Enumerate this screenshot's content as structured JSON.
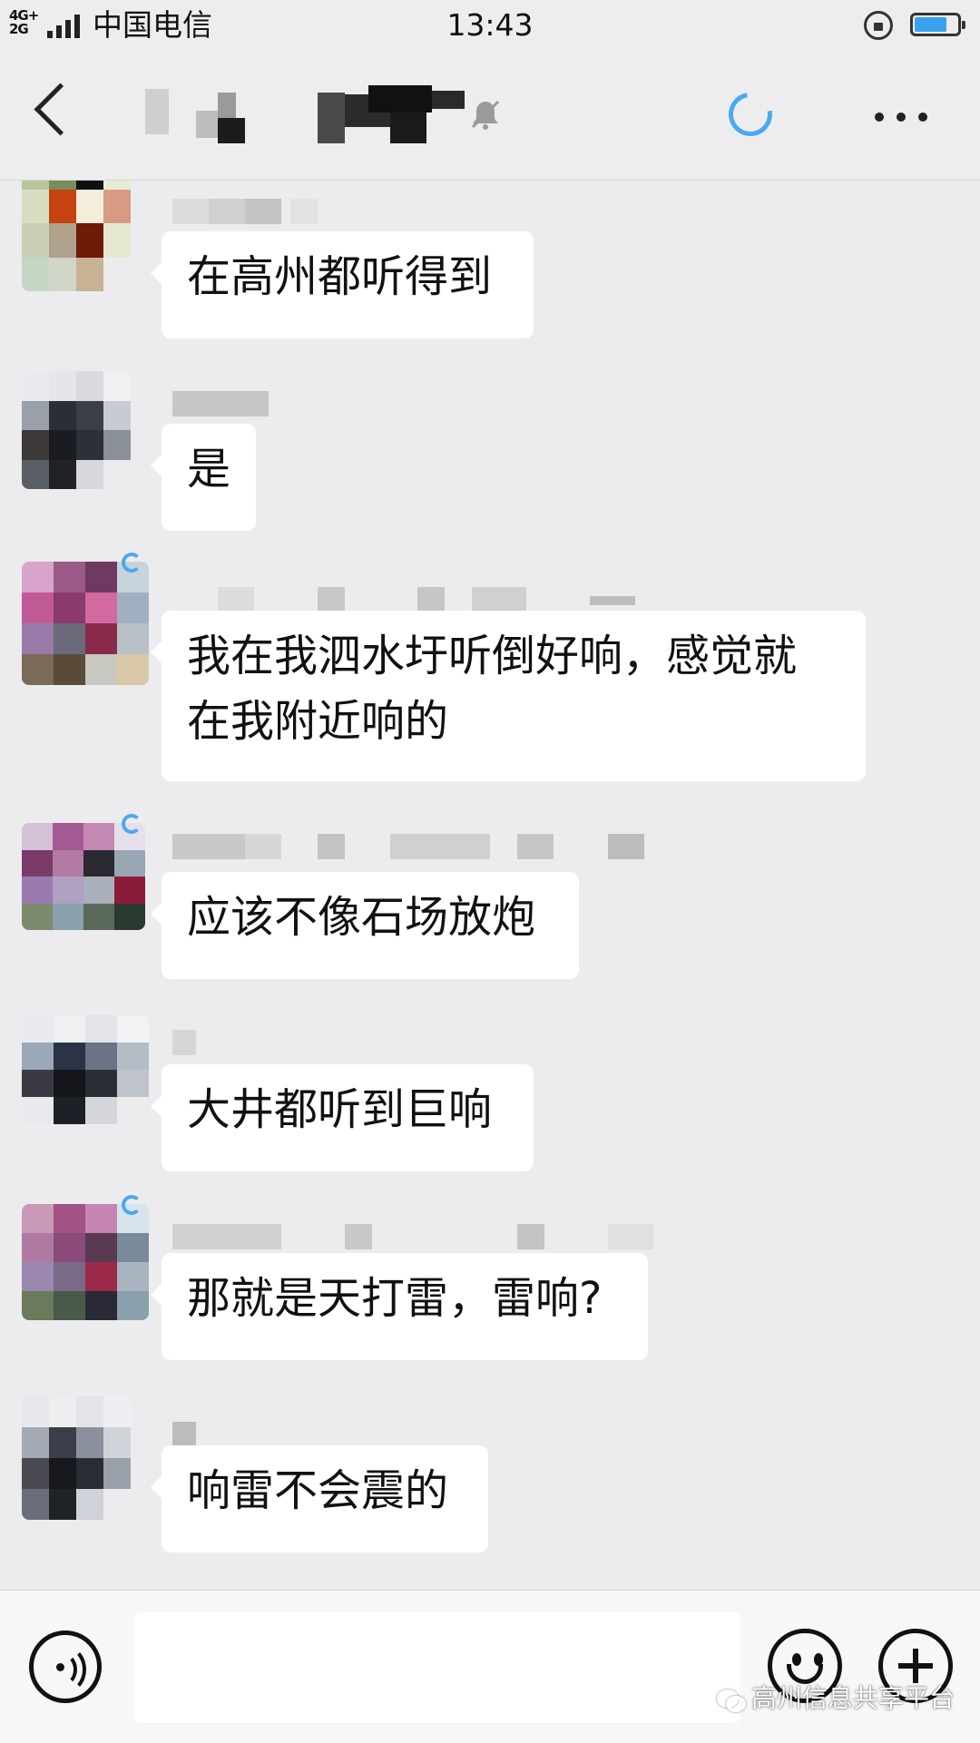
{
  "status_bar": {
    "network": "4G+ 2G",
    "carrier": "中国电信",
    "time": "13:43",
    "battery_level": 0.75,
    "icons": [
      "signal-icon",
      "rotation-lock-icon",
      "battery-icon"
    ]
  },
  "nav": {
    "back_icon": "chevron-left-icon",
    "title": "",
    "mute_icon": "bell-muted-icon",
    "loading_icon": "loading-spinner-icon",
    "more_icon": "more-dots-icon"
  },
  "messages": [
    {
      "sender": "",
      "text": "在高州都听得到"
    },
    {
      "sender": "",
      "text": "是"
    },
    {
      "sender": "",
      "text": "我在我泗水圩听倒好响，感觉就\n在我附近响的"
    },
    {
      "sender": "",
      "text": "应该不像石场放炮"
    },
    {
      "sender": "",
      "text": "大井都听到巨响"
    },
    {
      "sender": "",
      "text": "那就是天打雷，雷响?"
    },
    {
      "sender": "",
      "text": "响雷不会震的"
    }
  ],
  "input_bar": {
    "voice_icon": "voice-icon",
    "input_value": "",
    "emoji_icon": "emoji-icon",
    "plus_icon": "plus-icon"
  },
  "watermark": {
    "text": "高州信息共享平台",
    "icon": "wechat-icon"
  },
  "colors": {
    "background": "#ececee",
    "bubble": "#ffffff",
    "accent": "#4aa8f0"
  }
}
